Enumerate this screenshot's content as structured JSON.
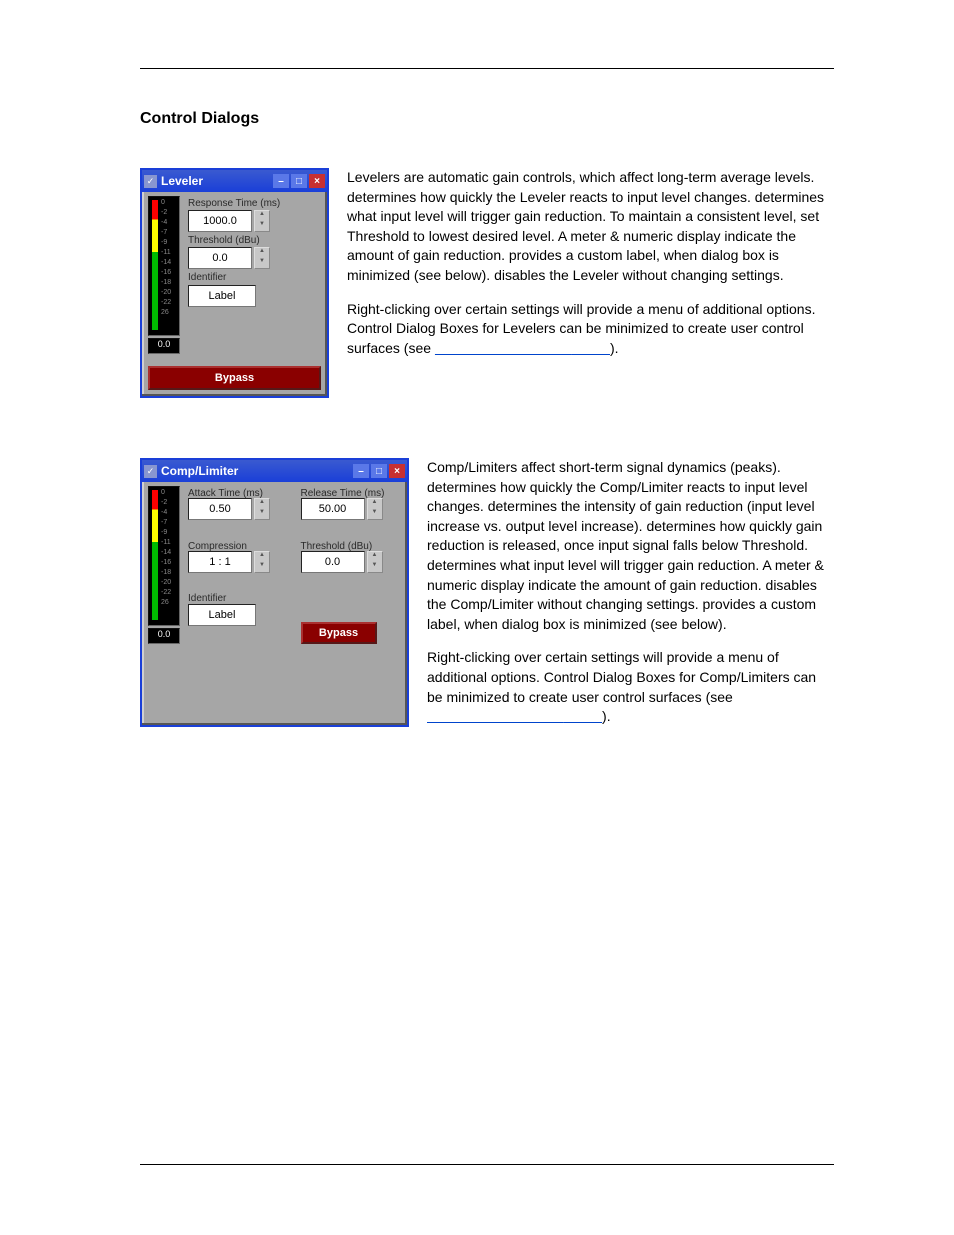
{
  "heading": "Control Dialogs",
  "meter": {
    "ticks": [
      "0",
      "-2",
      "-4",
      "-7",
      "-9",
      "-11",
      "-14",
      "-16",
      "-18",
      "-20",
      "-22",
      "26"
    ],
    "readout": "0.0"
  },
  "leveler": {
    "title": "Leveler",
    "responseLabel": "Response Time (ms)",
    "responseValue": "1000.0",
    "thresholdLabel": "Threshold (dBu)",
    "thresholdValue": "0.0",
    "identifierLabel": "Identifier",
    "identifierValue": "Label",
    "bypass": "Bypass"
  },
  "comp": {
    "title": "Comp/Limiter",
    "attackLabel": "Attack Time (ms)",
    "attackValue": "0.50",
    "releaseLabel": "Release Time (ms)",
    "releaseValue": "50.00",
    "compressionLabel": "Compression",
    "compressionValue": "1 : 1",
    "thresholdLabel": "Threshold (dBu)",
    "thresholdValue": "0.0",
    "identifierLabel": "Identifier",
    "identifierValue": "Label",
    "bypass": "Bypass"
  },
  "text": {
    "levP1a": "Levelers are automatic gain controls, which affect long-term average levels. ",
    "levP1b": " determines how quickly the Leveler reacts to input level changes. ",
    "levP1c": " determines what input level will trigger gain reduction. To maintain a consistent level, set Threshold to lowest desired level. A meter & numeric display indicate the amount of gain reduction. ",
    "levP1d": " provides a custom label, when dialog box is minimized (see below). ",
    "levP1e": " disables the Leveler without changing settings.",
    "levP2": "Right-clicking over certain settings will provide a menu of additional options. Control Dialog Boxes for Levelers can be minimized to create user control surfaces (see ",
    "linkBlank": "                                   ",
    "paren": ").",
    "compP1a": "Comp/Limiters affect short-term signal dynamics (peaks). ",
    "compP1b": " determines how quickly the Comp/Limiter reacts to input level changes. ",
    "compP1c": " determines the intensity of gain reduction (input level increase vs. output level increase). ",
    "compP1d": " determines how quickly gain reduction is released, once input signal falls below Threshold. ",
    "compP1e": " determines what input level will trigger gain reduction. A meter & numeric display indicate the amount of gain reduction. ",
    "compP1f": " disables the Comp/Limiter without changing settings. ",
    "compP1g": " provides a custom label, when dialog box is minimized (see below).",
    "compP2": "Right-clicking over certain settings will provide a menu of additional options. Control Dialog Boxes for Comp/Limiters can be minimized to create user control surfaces (see "
  }
}
